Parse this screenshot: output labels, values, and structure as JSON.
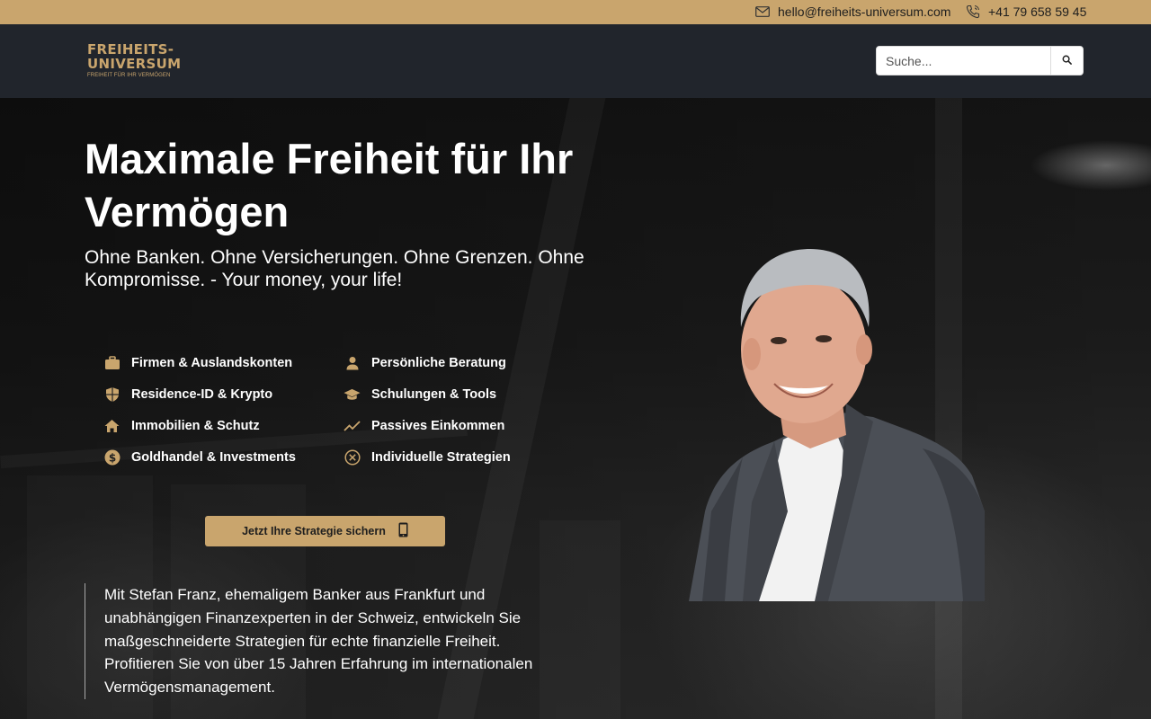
{
  "topbar": {
    "email": "hello@freiheits-universum.com",
    "phone": "+41 79 658 59 45",
    "email_icon": "mail-icon",
    "phone_icon": "phone-icon"
  },
  "header": {
    "logo_line1": "FREIHEITS-",
    "logo_line2": "UNIVERSUM",
    "logo_tagline": "FREIHEIT FÜR IHR VERMÖGEN",
    "search_placeholder": "Suche...",
    "search_icon": "search-icon"
  },
  "hero": {
    "title": "Maximale Freiheit für Ihr Vermögen",
    "subtitle": "Ohne Banken. Ohne Versicherungen. Ohne Grenzen. Ohne Kompromisse. - Your money, your life!",
    "features": [
      {
        "label": "Firmen & Auslandskonten",
        "icon": "briefcase-icon"
      },
      {
        "label": "Persönliche Beratung",
        "icon": "person-icon"
      },
      {
        "label": "Residence-ID & Krypto",
        "icon": "shield-icon"
      },
      {
        "label": "Schulungen & Tools",
        "icon": "graduation-cap-icon"
      },
      {
        "label": "Immobilien & Schutz",
        "icon": "house-icon"
      },
      {
        "label": "Passives Einkommen",
        "icon": "trend-icon"
      },
      {
        "label": "Goldhandel & Investments",
        "icon": "dollar-coin-icon"
      },
      {
        "label": "Individuelle Strategien",
        "icon": "circle-x-icon"
      }
    ],
    "cta_label": "Jetzt Ihre Strategie sichern",
    "cta_icon": "smartphone-icon",
    "description": "Mit Stefan Franz, ehemaligem Banker aus Frankfurt und unabhängigen Finanzexperten in der Schweiz, entwickeln Sie maßgeschneiderte Strategien für echte finanzielle Freiheit. Profitieren Sie von über 15 Jahren Erfahrung im internationalen Vermögensmanagement."
  },
  "colors": {
    "accent": "#c9a56d",
    "header_bg": "#21252c"
  }
}
